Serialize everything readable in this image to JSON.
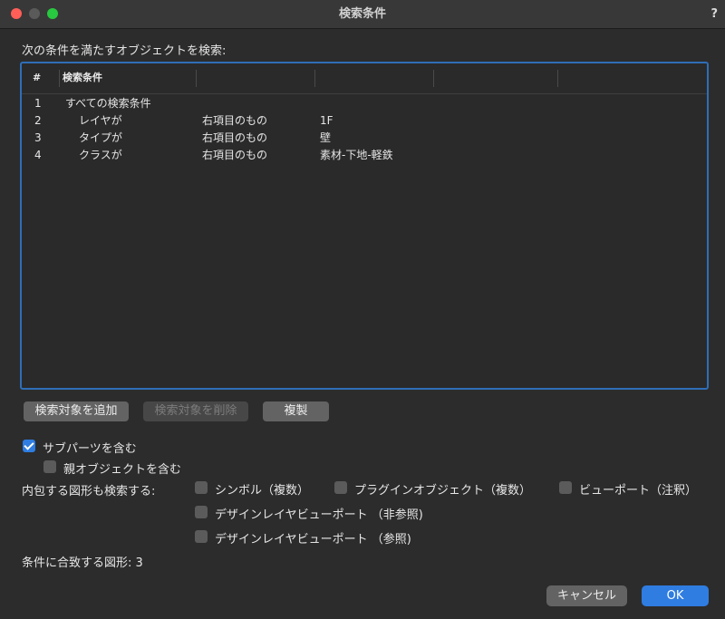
{
  "window": {
    "title": "検索条件",
    "help_label": "?"
  },
  "heading": "次の条件を満たすオブジェクトを検索:",
  "table": {
    "columns": [
      "#",
      "検索条件",
      "",
      "",
      "",
      ""
    ],
    "rows": [
      {
        "num": "1",
        "condition": "すべての検索条件",
        "operator": "",
        "value": "",
        "indent": false
      },
      {
        "num": "2",
        "condition": "レイヤが",
        "operator": "右項目のもの",
        "value": "1F",
        "indent": true
      },
      {
        "num": "3",
        "condition": "タイプが",
        "operator": "右項目のもの",
        "value": "壁",
        "indent": true
      },
      {
        "num": "4",
        "condition": "クラスが",
        "operator": "右項目のもの",
        "value": "素材-下地-軽鉄",
        "indent": true
      }
    ]
  },
  "buttons": {
    "add": "検索対象を追加",
    "delete": "検索対象を削除",
    "duplicate": "複製"
  },
  "options": {
    "subparts": {
      "label": "サブパーツを含む",
      "checked": true
    },
    "parent": {
      "label": "親オブジェクトを含む",
      "checked": false
    },
    "nested_label": "内包する図形も検索する:",
    "symbols": {
      "label": "シンボル（複数）",
      "checked": false
    },
    "plugins": {
      "label": "プラグインオブジェクト（複数）",
      "checked": false
    },
    "viewports": {
      "label": "ビューポート（注釈）",
      "checked": false
    },
    "dlvp_nonref": {
      "label": "デザインレイヤビューポート （非参照)",
      "checked": false
    },
    "dlvp_ref": {
      "label": "デザインレイヤビューポート （参照)",
      "checked": false
    }
  },
  "match_count": "条件に合致する図形:  3",
  "footer": {
    "cancel": "キャンセル",
    "ok": "OK"
  },
  "colors": {
    "accent": "#2f7de1",
    "focus_border": "#2f6eb7",
    "background": "#2c2c2c"
  }
}
